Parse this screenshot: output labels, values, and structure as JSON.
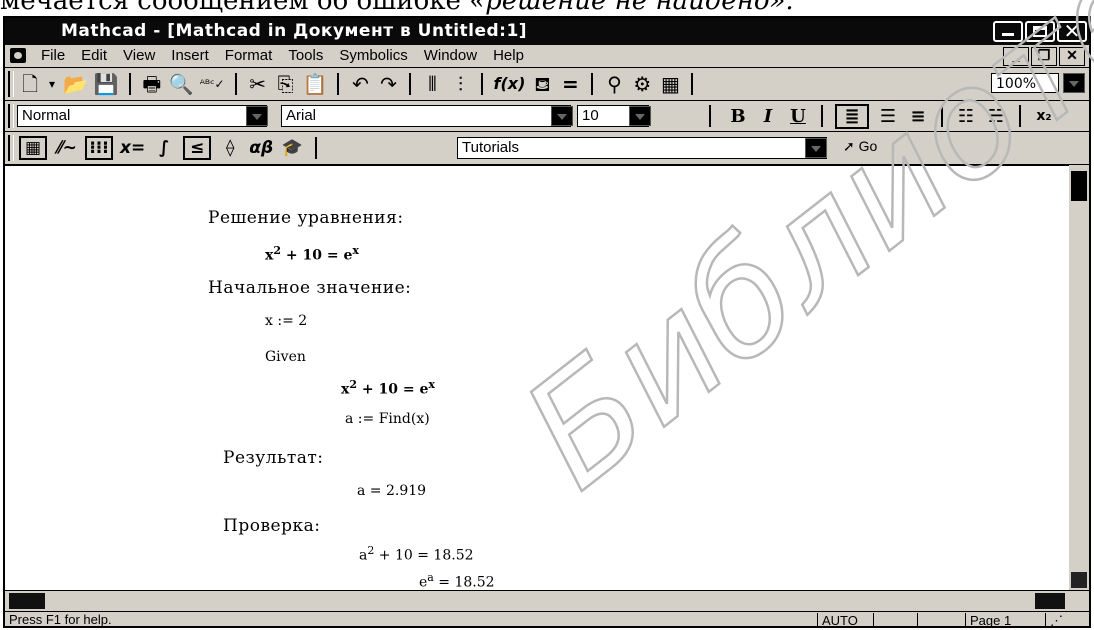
{
  "top_text": {
    "regular": "мечается сообщением об ошибке",
    "italic": "«решение не найдено»."
  },
  "window": {
    "title": "Mathcad - [Mathcad in Документ в Untitled:1]"
  },
  "menu": {
    "items": [
      "File",
      "Edit",
      "View",
      "Insert",
      "Format",
      "Tools",
      "Symbolics",
      "Window",
      "Help"
    ]
  },
  "toolbar": {
    "zoom": "100%",
    "style_select": "Normal",
    "font_select": "Arial",
    "size_select": "10",
    "bold_label": "B",
    "italic_label": "I",
    "underline_label": "U"
  },
  "math_toolbar": {
    "tutorials": "Tutorials",
    "go": "Go",
    "eval_label": "x=",
    "greek_label": "αβ"
  },
  "worksheet": {
    "heading_solution": "Решение уравнения:",
    "eq1": {
      "lhs": "x",
      "exp1": "2",
      "mid": " + 10 = e",
      "exp2": "x"
    },
    "heading_initial": "Начальное значение:",
    "assign_x": "x := 2",
    "given": "Given",
    "eq2": {
      "lhs": "x",
      "exp1": "2",
      "mid": " + 10 = e",
      "exp2": "x"
    },
    "find": "a := Find(x)",
    "heading_result": "Результат:",
    "result": "a = 2.919",
    "heading_check": "Проверка:",
    "check1": {
      "lhs": "a",
      "exp": "2",
      "rest": " + 10 = 18.52"
    },
    "check2": {
      "lhs": "e",
      "exp": "a",
      "rest": " = 18.52"
    }
  },
  "status": {
    "help": "Press F1 for help.",
    "mode": "AUTO",
    "page": "Page 1"
  },
  "watermark": {
    "text": "Библиотека БГУИР",
    "color": "#b8b8b8"
  }
}
